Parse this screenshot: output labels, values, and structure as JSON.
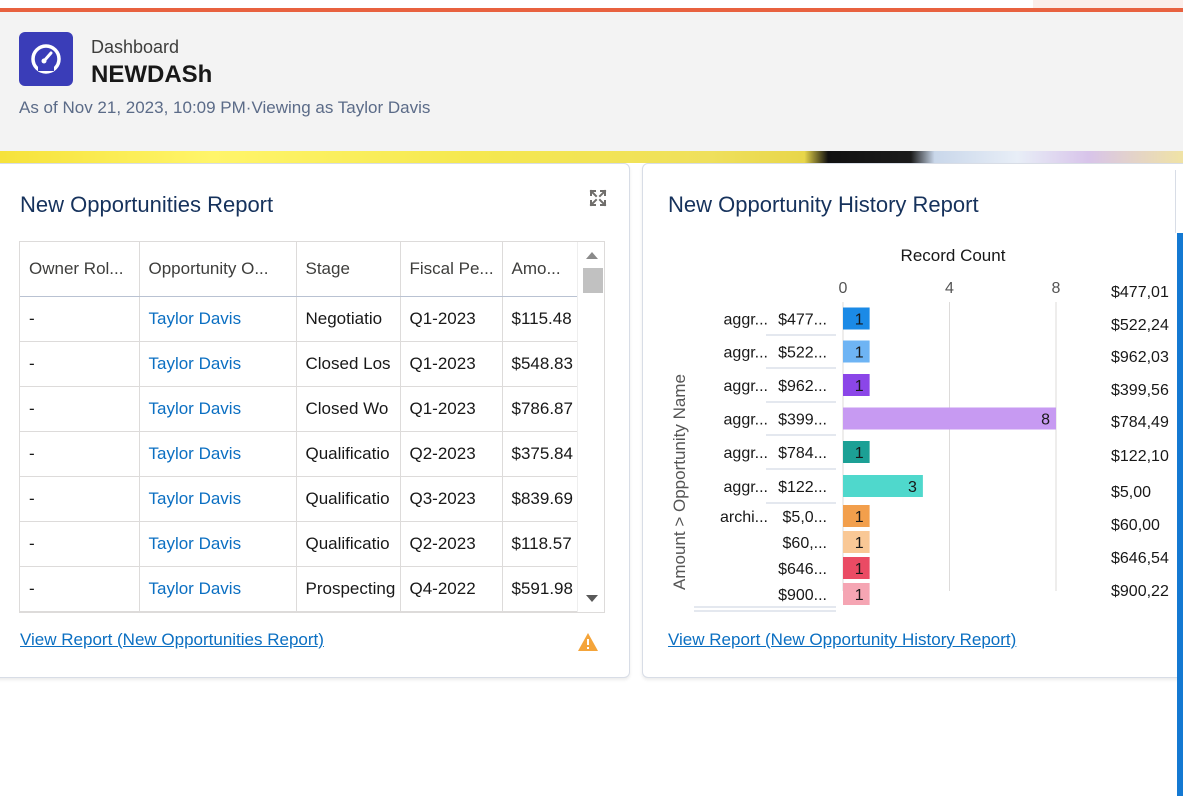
{
  "header": {
    "type_label": "Dashboard",
    "title": "NEWDASh",
    "as_of": "As of Nov 21, 2023, 10:09 PM·Viewing as Taylor Davis",
    "icon": "dashboard-gauge-icon",
    "icon_color": "#3a3db8"
  },
  "card1": {
    "title": "New Opportunities Report",
    "expand_icon": "expand-icon",
    "columns": [
      "Owner Rol...",
      "Opportunity O...",
      "Stage",
      "Fiscal Pe...",
      "Amo..."
    ],
    "rows": [
      {
        "owner_role": "-",
        "owner": "Taylor Davis",
        "stage": "Negotiatio",
        "fiscal": "Q1-2023",
        "amount": "$115.48"
      },
      {
        "owner_role": "-",
        "owner": "Taylor Davis",
        "stage": "Closed Los",
        "fiscal": "Q1-2023",
        "amount": "$548.83"
      },
      {
        "owner_role": "-",
        "owner": "Taylor Davis",
        "stage": "Closed Wo",
        "fiscal": "Q1-2023",
        "amount": "$786.87"
      },
      {
        "owner_role": "-",
        "owner": "Taylor Davis",
        "stage": "Qualificatio",
        "fiscal": "Q2-2023",
        "amount": "$375.84"
      },
      {
        "owner_role": "-",
        "owner": "Taylor Davis",
        "stage": "Qualificatio",
        "fiscal": "Q3-2023",
        "amount": "$839.69"
      },
      {
        "owner_role": "-",
        "owner": "Taylor Davis",
        "stage": "Qualificatio",
        "fiscal": "Q2-2023",
        "amount": "$118.57"
      },
      {
        "owner_role": "-",
        "owner": "Taylor Davis",
        "stage": "Prospecting",
        "fiscal": "Q4-2022",
        "amount": "$591.98"
      }
    ],
    "footer_link": "View Report (New Opportunities Report)",
    "warning_icon": "warning-icon",
    "warning_color": "#f4a43a"
  },
  "card2": {
    "title": "New Opportunity History Report",
    "footer_link": "View Report (New Opportunity History Report)",
    "right_values": [
      "$477,01",
      "$522,24",
      "$962,03",
      "$399,56",
      "$784,49",
      "$122,10",
      "$5,00",
      "$60,00",
      "$646,54",
      "$900,22"
    ]
  },
  "chart_data": {
    "type": "bar",
    "orientation": "horizontal",
    "title": "Record Count",
    "ylabel": "Amount  >  Opportunity Name",
    "xlim": [
      0,
      8
    ],
    "x_ticks": [
      0,
      4,
      8
    ],
    "x_tick_labels": [
      "0",
      "4",
      "8"
    ],
    "grid": true,
    "groups": [
      "aggr...",
      "aggr...",
      "aggr...",
      "aggr...",
      "aggr...",
      "aggr...",
      "archi..."
    ],
    "categories": [
      {
        "group": "aggr...",
        "label": "$477...",
        "value": 1,
        "color": "#1b8ae6"
      },
      {
        "group": "aggr...",
        "label": "$522...",
        "value": 1,
        "color": "#6eb4f4"
      },
      {
        "group": "aggr...",
        "label": "$962...",
        "value": 1,
        "color": "#8b46e8"
      },
      {
        "group": "aggr...",
        "label": "$399...",
        "value": 8,
        "color": "#c79af2"
      },
      {
        "group": "aggr...",
        "label": "$784...",
        "value": 1,
        "color": "#1ca095"
      },
      {
        "group": "aggr...",
        "label": "$122...",
        "value": 3,
        "color": "#4fd8cc"
      },
      {
        "group": "archi...",
        "label": "$5,0...",
        "value": 1,
        "color": "#f29f4c"
      },
      {
        "group": "",
        "label": "$60,...",
        "value": 1,
        "color": "#f9c896"
      },
      {
        "group": "",
        "label": "$646...",
        "value": 1,
        "color": "#ea4b64"
      },
      {
        "group": "",
        "label": "$900...",
        "value": 1,
        "color": "#f5a5b3"
      }
    ]
  }
}
